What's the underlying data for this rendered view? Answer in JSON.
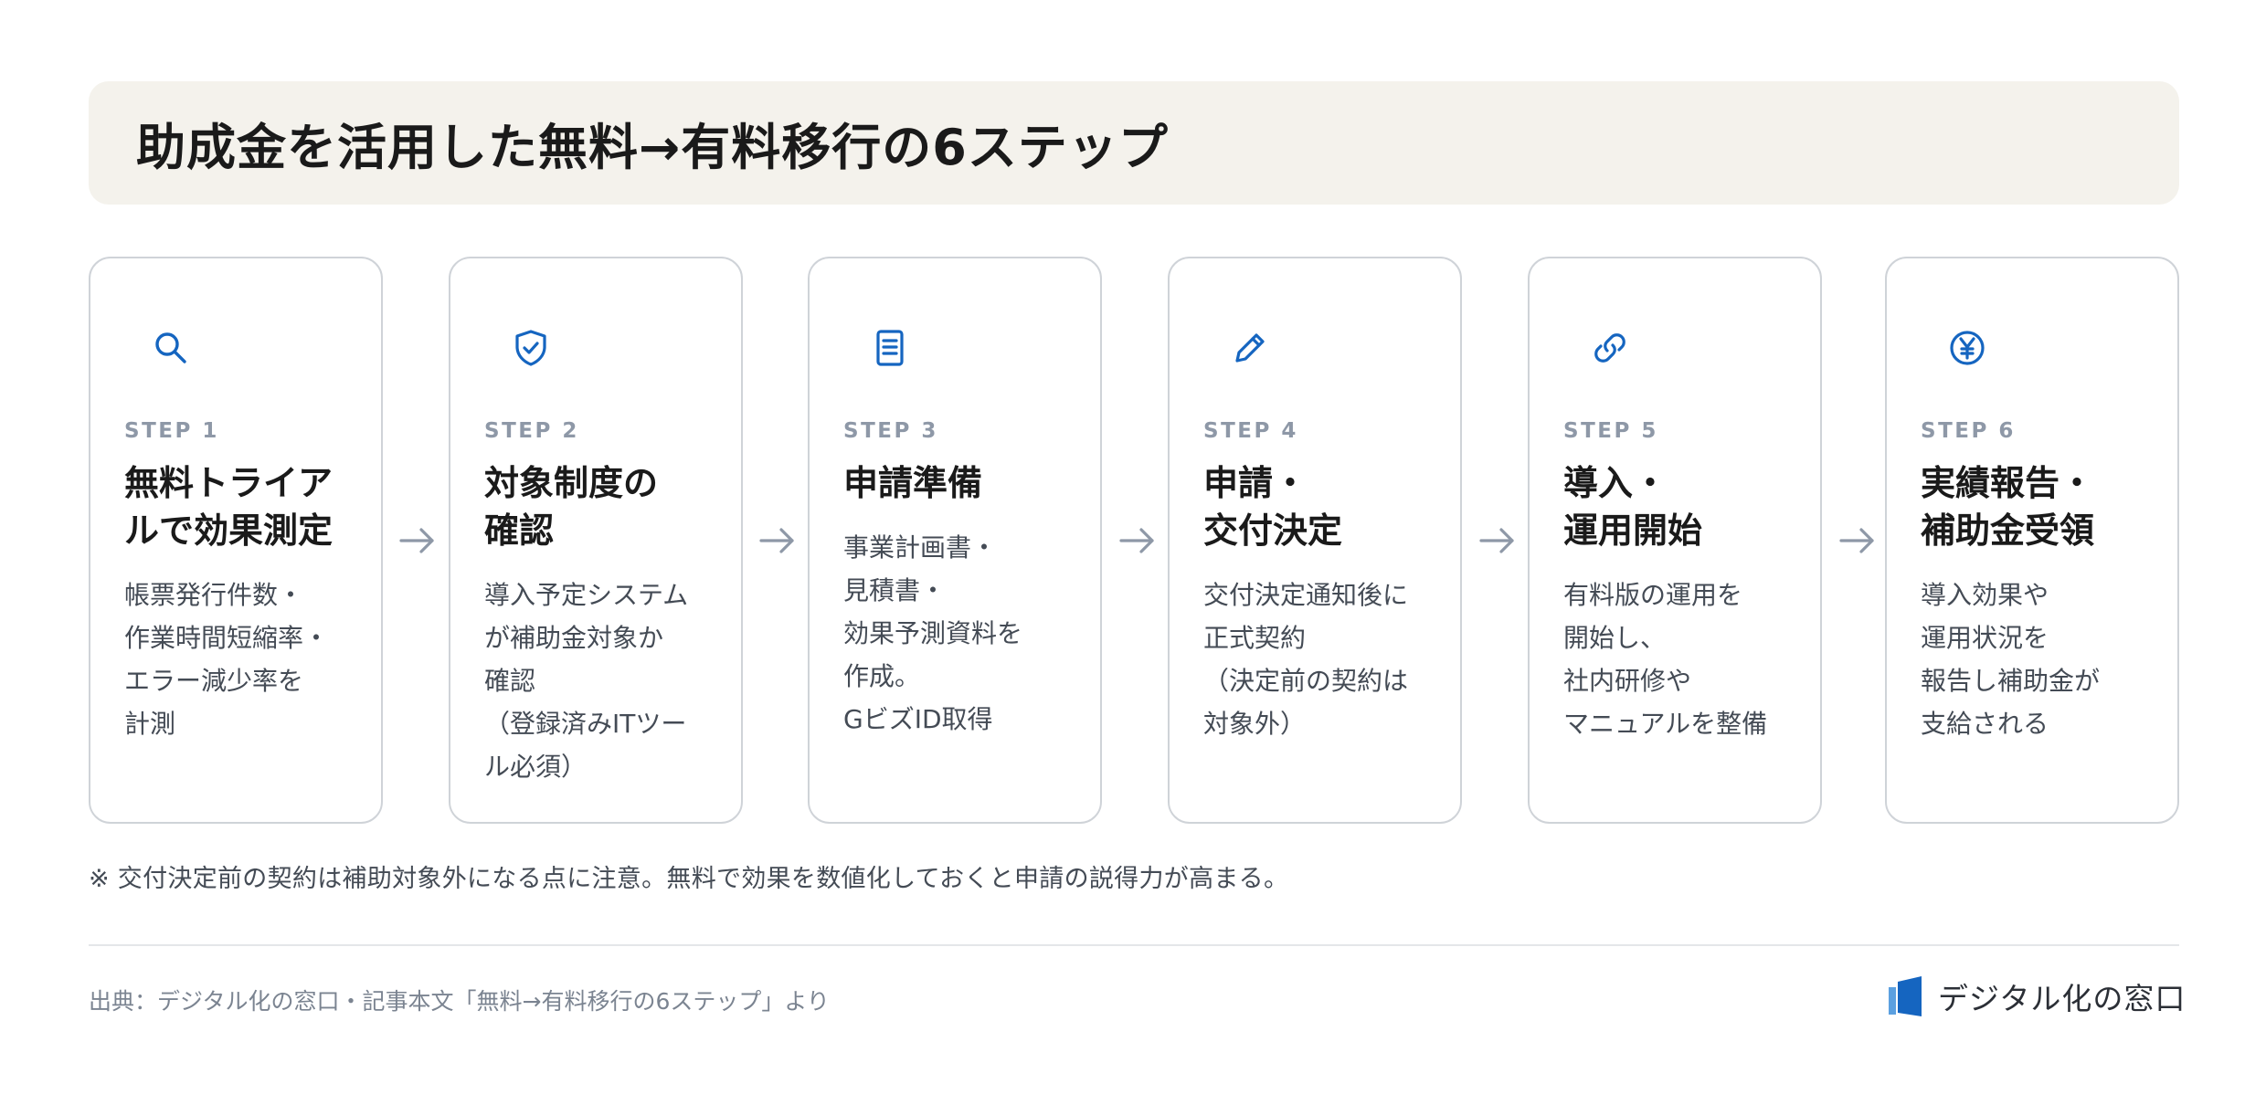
{
  "title": "助成金を活用した無料→有料移行の6ステップ",
  "colors": {
    "accent": "#1565c0",
    "step_label": "#8e98a7",
    "title_bg": "#f4f2ec",
    "card_border": "#cfd3d8",
    "arrow": "#8e98a7"
  },
  "steps": [
    {
      "label": "STEP 1",
      "icon": "search-icon",
      "title": [
        "無料トライア",
        "ルで効果測定"
      ],
      "desc": [
        "帳票発行件数・",
        "作業時間短縮率・",
        "エラー減少率を",
        "計測"
      ]
    },
    {
      "label": "STEP 2",
      "icon": "shield-check-icon",
      "title": [
        "対象制度の",
        "確認"
      ],
      "desc": [
        "導入予定システム",
        "が補助金対象か",
        "確認",
        "（登録済みITツー",
        "ル必須）"
      ]
    },
    {
      "label": "STEP 3",
      "icon": "document-icon",
      "title": [
        "申請準備"
      ],
      "desc": [
        "事業計画書・",
        "見積書・",
        "効果予測資料を",
        "作成。",
        "GビズID取得"
      ]
    },
    {
      "label": "STEP 4",
      "icon": "pen-icon",
      "title": [
        "申請・",
        "交付決定"
      ],
      "desc": [
        "交付決定通知後に",
        "正式契約",
        "（決定前の契約は",
        "対象外）"
      ]
    },
    {
      "label": "STEP 5",
      "icon": "link-icon",
      "title": [
        "導入・",
        "運用開始"
      ],
      "desc": [
        "有料版の運用を",
        "開始し、",
        "社内研修や",
        "マニュアルを整備"
      ]
    },
    {
      "label": "STEP 6",
      "icon": "yen-icon",
      "title": [
        "実績報告・",
        "補助金受領"
      ],
      "desc": [
        "導入効果や",
        "運用状況を",
        "報告し補助金が",
        "支給される"
      ]
    }
  ],
  "note": "※ 交付決定前の契約は補助対象外になる点に注意。無料で効果を数値化しておくと申請の説得力が高まる。",
  "source": "出典：デジタル化の窓口・記事本文「無料→有料移行の6ステップ」より",
  "logo": {
    "text": "デジタル化の窓口"
  }
}
